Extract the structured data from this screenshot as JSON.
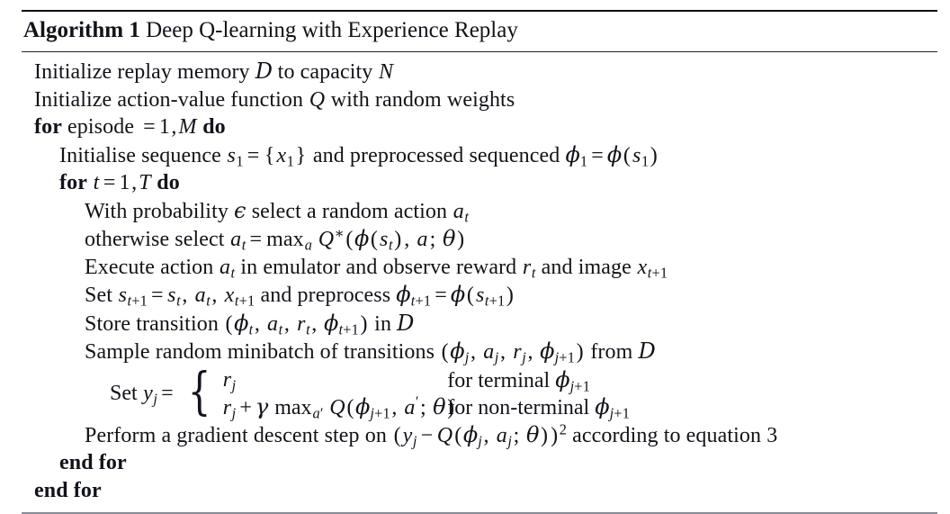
{
  "caption": {
    "label": "Algorithm 1",
    "text": "Deep Q-learning with Experience Replay"
  },
  "lines": {
    "l1": {
      "pre": "Initialize replay memory ",
      "mid": " to capacity ",
      "post": ""
    },
    "l2": {
      "pre": "Initialize action-value function ",
      "post": " with random weights"
    },
    "l3": {
      "kw1": "for",
      "mid": " episode ",
      "kw2": "do"
    },
    "l4": {
      "pre": "Initialise sequence ",
      "mid": " and preprocessed sequenced "
    },
    "l5": {
      "kw1": "for",
      "kw2": "do"
    },
    "l6": {
      "pre": "With probability ",
      "mid": " select a random action "
    },
    "l7": {
      "pre": "otherwise select "
    },
    "l8": {
      "pre": "Execute action ",
      "mid": " in emulator and observe reward ",
      "post": " and image "
    },
    "l9": {
      "pre": "Set ",
      "mid": " and preprocess "
    },
    "l10": {
      "pre": "Store transition ",
      "post": " in "
    },
    "l11": {
      "pre": "Sample random minibatch of transitions ",
      "post": " from "
    },
    "l12": {
      "head": "Set ",
      "case1_cond": "for terminal ",
      "case2_cond": "for non-terminal "
    },
    "l13": {
      "pre": "Perform a gradient descent step on ",
      "post": " according to equation 3"
    },
    "l14": {
      "kw": "end for"
    },
    "l15": {
      "kw": "end for"
    }
  },
  "symbols": {
    "D": "D",
    "N": "N",
    "Q": "Q",
    "M": "M",
    "T": "T",
    "t": "t",
    "j": "j",
    "s": "s",
    "x": "x",
    "a": "a",
    "r": "r",
    "y": "y",
    "phi": "ϕ",
    "epsilon": "ϵ",
    "theta": "θ",
    "gamma": "γ",
    "one": "1",
    "two": "2",
    "three": "3",
    "max": "max",
    "star": "∗",
    "prime": "′",
    "eq": "=",
    "plus": "+",
    "minus": "−",
    "comma": ",",
    "semi": ";",
    "lparen": "(",
    "rparen": ")",
    "lbrace": "{",
    "rbrace": "}"
  },
  "colors": {
    "text": "#12131a",
    "rule_dark": "#0d0f16",
    "rule_mid": "#23262e",
    "rule_bottom": "#878b93",
    "background": "#ffffff"
  }
}
